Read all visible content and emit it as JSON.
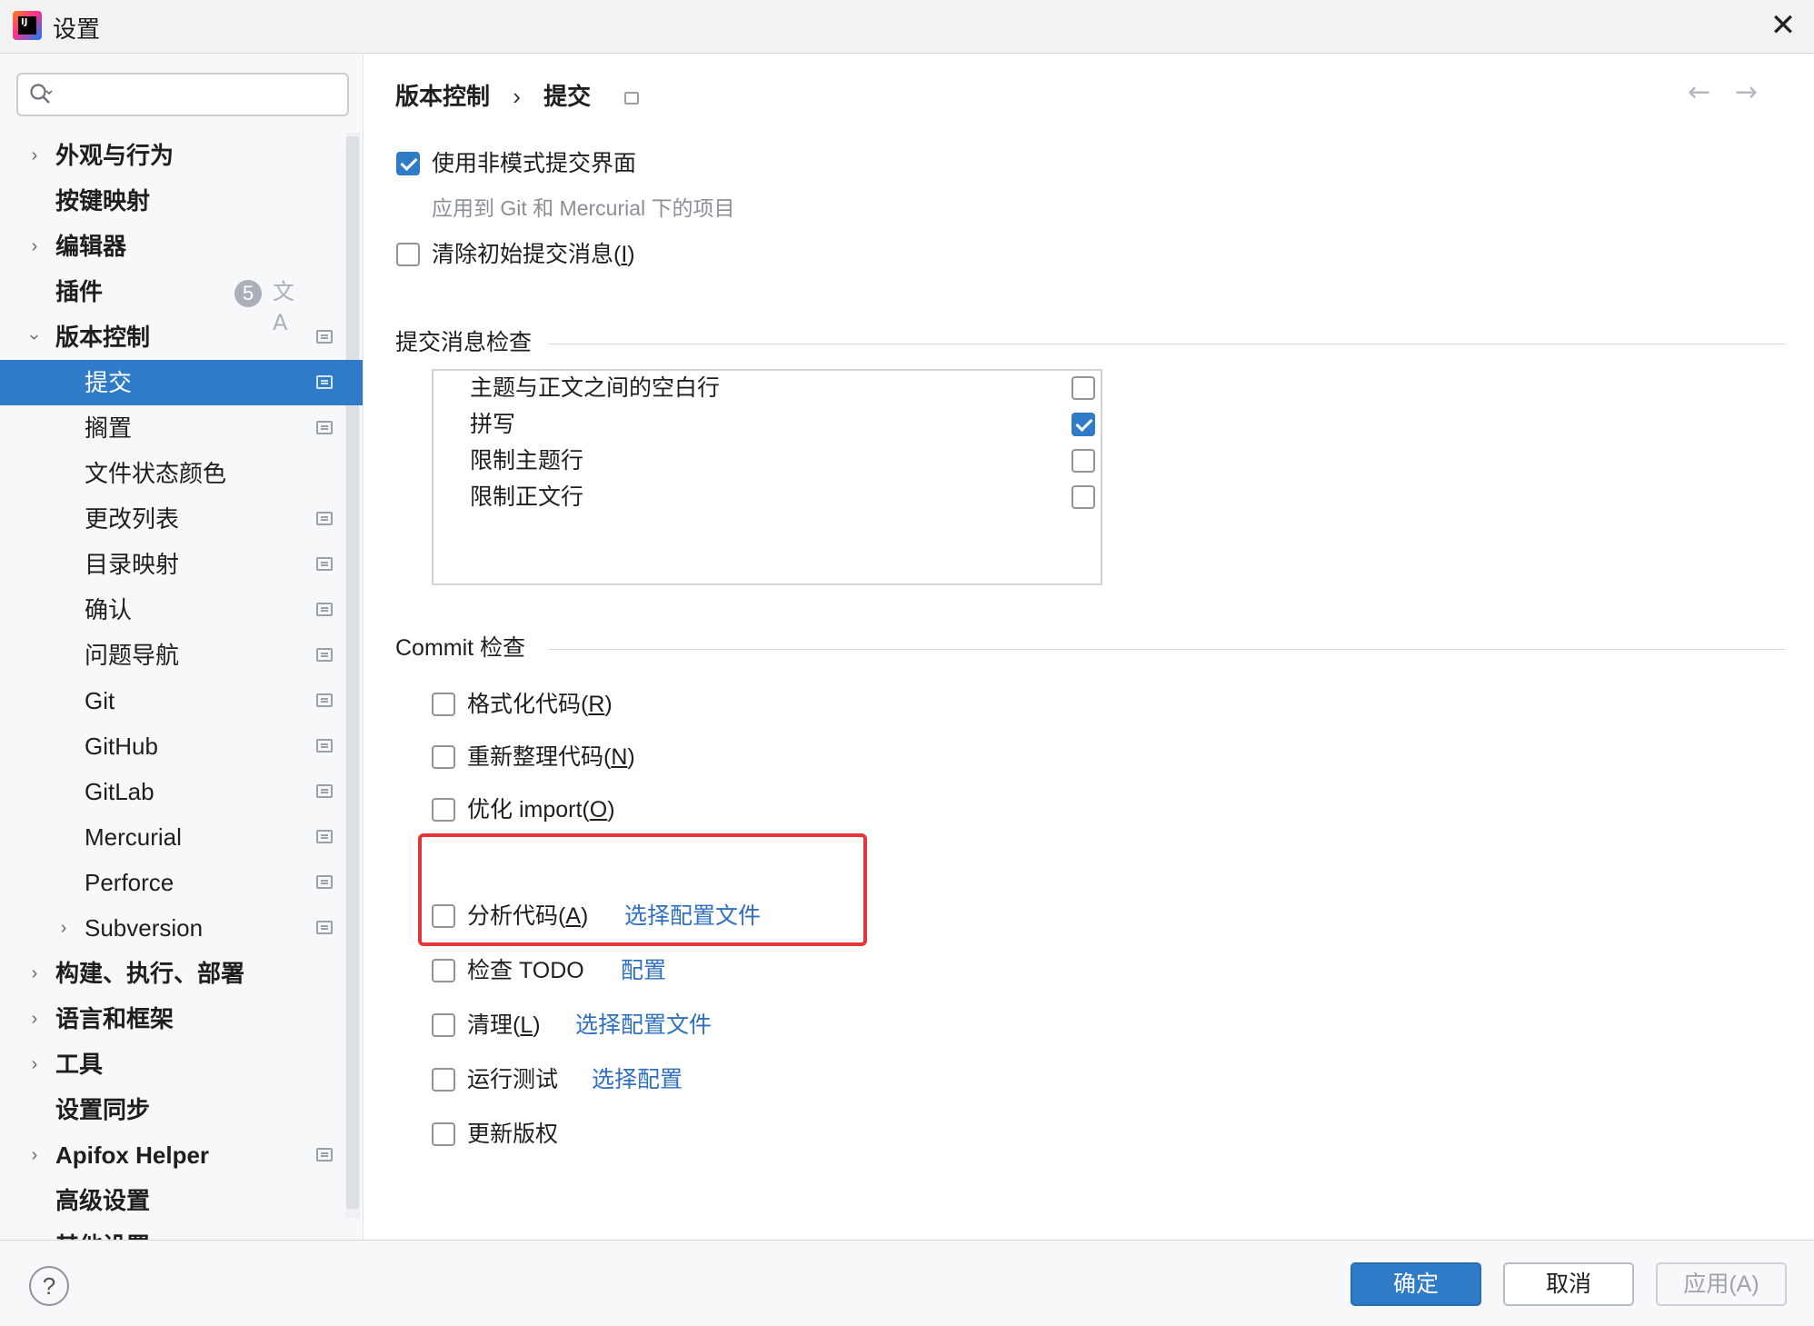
{
  "window": {
    "title": "设置",
    "close_icon": "close-icon"
  },
  "sidebar": {
    "search": {
      "placeholder": "",
      "value": ""
    },
    "plugins_badge": "5",
    "items": [
      {
        "label": "外观与行为"
      },
      {
        "label": "按键映射"
      },
      {
        "label": "编辑器"
      },
      {
        "label": "插件"
      },
      {
        "label": "版本控制"
      },
      {
        "label": "提交"
      },
      {
        "label": "搁置"
      },
      {
        "label": "文件状态颜色"
      },
      {
        "label": "更改列表"
      },
      {
        "label": "目录映射"
      },
      {
        "label": "确认"
      },
      {
        "label": "问题导航"
      },
      {
        "label": "Git"
      },
      {
        "label": "GitHub"
      },
      {
        "label": "GitLab"
      },
      {
        "label": "Mercurial"
      },
      {
        "label": "Perforce"
      },
      {
        "label": "Subversion"
      },
      {
        "label": "构建、执行、部署"
      },
      {
        "label": "语言和框架"
      },
      {
        "label": "工具"
      },
      {
        "label": "设置同步"
      },
      {
        "label": "Apifox Helper"
      },
      {
        "label": "高级设置"
      },
      {
        "label": "其他设置"
      }
    ]
  },
  "breadcrumb": {
    "parent": "版本控制",
    "separator": "›",
    "current": "提交"
  },
  "general": {
    "non_modal": {
      "label": "使用非模式提交界面",
      "checked": true,
      "hint": "应用到 Git 和 Mercurial 下的项目"
    },
    "clear_initial": {
      "label": "清除初始提交消息(",
      "mnemonic": "I",
      "suffix": ")",
      "checked": false
    }
  },
  "message_checks": {
    "title": "提交消息检查",
    "items": [
      {
        "label": "主题与正文之间的空白行",
        "checked": false
      },
      {
        "label": "拼写",
        "checked": true
      },
      {
        "label": "限制主题行",
        "checked": false
      },
      {
        "label": "限制正文行",
        "checked": false
      }
    ]
  },
  "commit_checks": {
    "title": "Commit 检查",
    "format": {
      "label": "格式化代码(",
      "mnemonic": "R",
      "suffix": ")"
    },
    "rearrange": {
      "label": "重新整理代码(",
      "mnemonic": "N",
      "suffix": ")"
    },
    "optimize": {
      "label": "优化 import(",
      "mnemonic": "O",
      "suffix": ")"
    },
    "analyze": {
      "label": "分析代码(",
      "mnemonic": "A",
      "suffix": ")",
      "link": "选择配置文件"
    },
    "todo": {
      "label": "检查 TODO",
      "link": "配置"
    },
    "cleanup": {
      "label": "清理(",
      "mnemonic": "L",
      "suffix": ")",
      "link": "选择配置文件"
    },
    "tests": {
      "label": "运行测试",
      "link": "选择配置"
    },
    "copyright": {
      "label": "更新版权"
    }
  },
  "footer": {
    "help": "?",
    "ok": "确定",
    "cancel": "取消",
    "apply": "应用(A)"
  },
  "colors": {
    "accent": "#2f7bc8",
    "link": "#2f6fc0",
    "highlight_border": "#e5353b"
  }
}
